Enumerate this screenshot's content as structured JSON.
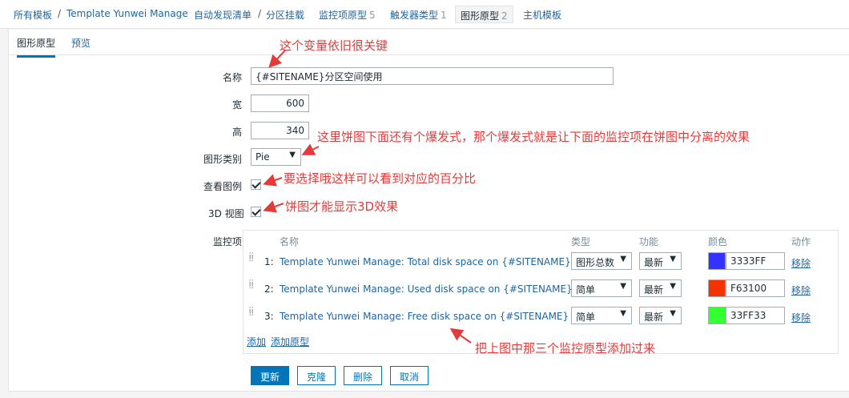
{
  "breadcrumb": {
    "all_templates": "所有模板",
    "template": "Template Yunwei Manage",
    "discovery_list": "自动发现清单",
    "rule": "分区挂载",
    "item_prototypes": "监控项原型",
    "item_prototypes_count": "5",
    "trigger_types": "触发器类型",
    "trigger_types_count": "1",
    "graph_prototypes": "图形原型",
    "graph_prototypes_count": "2",
    "host_templates": "主机模板"
  },
  "tabs": {
    "graph_prototype": "图形原型",
    "preview": "预览"
  },
  "form": {
    "name_label": "名称",
    "name_value": "{#SITENAME}分区空间使用",
    "width_label": "宽",
    "width_value": "600",
    "height_label": "高",
    "height_value": "340",
    "type_label": "图形类别",
    "type_value": "Pie",
    "legend_label": "查看图例",
    "view3d_label": "3D 视图",
    "items_label": "监控项"
  },
  "items_table": {
    "headers": {
      "name": "名称",
      "type": "类型",
      "function": "功能",
      "color": "颜色",
      "action": "动作"
    },
    "rows": [
      {
        "num": "1:",
        "name": "Template Yunwei Manage: Total disk space on {#SITENAME}",
        "type": "图形总数",
        "function": "最新",
        "color": "3333FF",
        "remove": "移除"
      },
      {
        "num": "2:",
        "name": "Template Yunwei Manage: Used disk space on {#SITENAME}",
        "type": "简单",
        "function": "最新",
        "color": "F63100",
        "remove": "移除"
      },
      {
        "num": "3:",
        "name": "Template Yunwei Manage: Free disk space on {#SITENAME}",
        "type": "简单",
        "function": "最新",
        "color": "33FF33",
        "remove": "移除"
      }
    ],
    "add": "添加",
    "add_prototype": "添加原型"
  },
  "buttons": {
    "update": "更新",
    "clone": "克隆",
    "delete": "删除",
    "cancel": "取消"
  },
  "annotations": {
    "name_note": "这个变量依旧很关键",
    "type_note": "这里饼图下面还有个爆发式，那个爆发式就是让下面的监控项在饼图中分离的效果",
    "legend_note": "要选择哦这样可以看到对应的百分比",
    "view3d_note": "饼图才能显示3D效果",
    "items_note": "把上图中那三个监控原型添加过来"
  },
  "colors": {
    "accent": "#0275b8",
    "annotation": "#e33b3b",
    "link": "#1f65a0"
  }
}
